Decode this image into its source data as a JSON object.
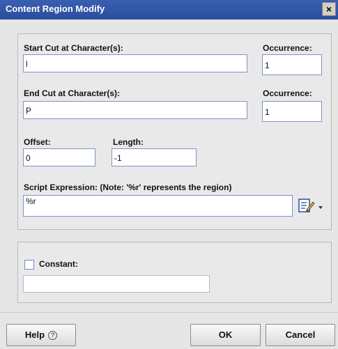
{
  "window": {
    "title": "Content Region Modify",
    "close_glyph": "×"
  },
  "start_cut": {
    "label": "Start Cut at Character(s):",
    "value": "l"
  },
  "start_occurrence": {
    "label": "Occurrence:",
    "value": "1"
  },
  "end_cut": {
    "label": "End Cut at Character(s):",
    "value": "P"
  },
  "end_occurrence": {
    "label": "Occurrence:",
    "value": "1"
  },
  "offset": {
    "label": "Offset:",
    "value": "0"
  },
  "length": {
    "label": "Length:",
    "value": "-1"
  },
  "script": {
    "label": "Script Expression: (Note: '%r' represents the region)",
    "value": "%r",
    "editor_icon": "script-editor-icon"
  },
  "constant": {
    "label": "Constant:",
    "checked": false,
    "value": ""
  },
  "buttons": {
    "help": "Help",
    "ok": "OK",
    "cancel": "Cancel"
  },
  "colors": {
    "titlebar": "#2f54a6",
    "title_text": "#ffffff",
    "field_border": "#7a95c5",
    "panel_bg": "#e9e9e9",
    "dialog_bg": "#e6e6e6"
  }
}
